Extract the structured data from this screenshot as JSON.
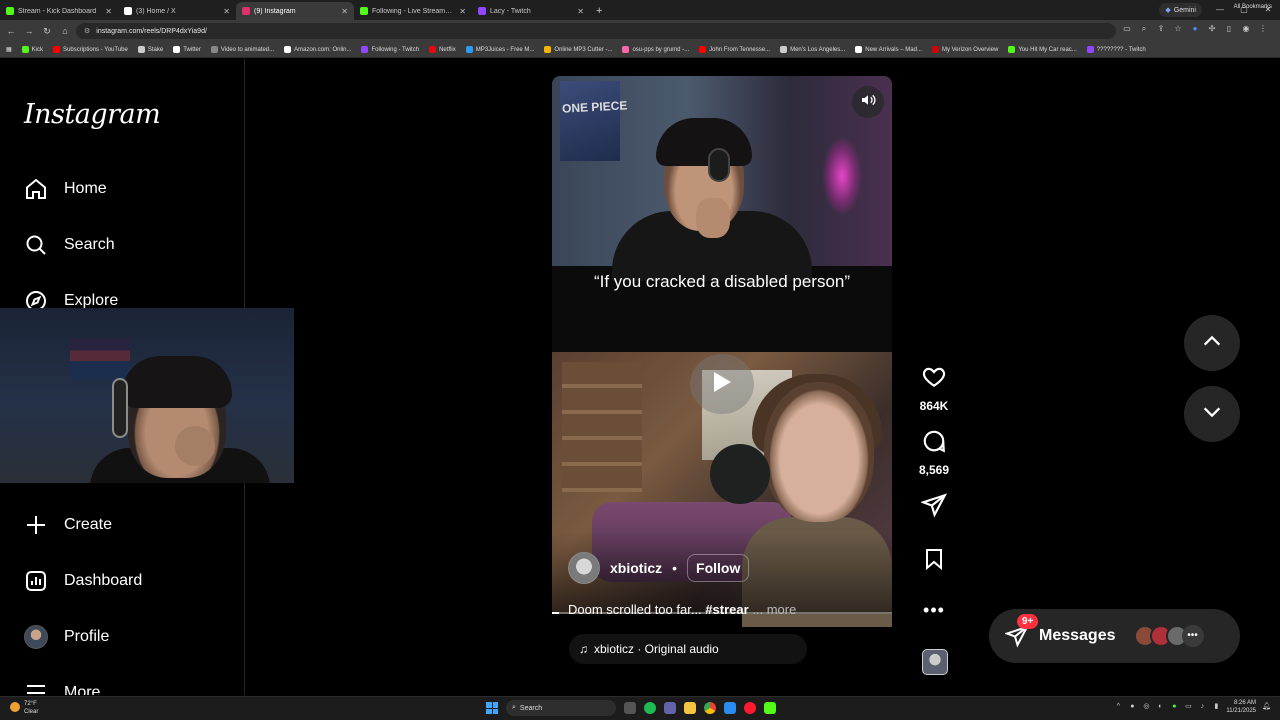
{
  "browser": {
    "tabs": [
      {
        "label": "Stream - Kick Dashboard",
        "color": "#53fc18",
        "active": false
      },
      {
        "label": "(3) Home / X",
        "color": "#ffffff",
        "active": false
      },
      {
        "label": "(9) Instagram",
        "color": "#e1306c",
        "active": true
      },
      {
        "label": "Following - Live Streams on Kick",
        "color": "#53fc18",
        "active": false
      },
      {
        "label": "Lacy - Twitch",
        "color": "#9146ff",
        "active": false
      }
    ],
    "gemini_label": "Gemini",
    "url": "instagram.com/reels/DRP4dxYia9d/",
    "bookmarks": [
      {
        "label": "Kick",
        "color": "#53fc18"
      },
      {
        "label": "Subscriptions - YouTube",
        "color": "#ff0000"
      },
      {
        "label": "Stake",
        "color": "#cccccc"
      },
      {
        "label": "Twitter",
        "color": "#ffffff"
      },
      {
        "label": "Video to animated...",
        "color": "#888888"
      },
      {
        "label": "Amazon.com: Onlin...",
        "color": "#ffffff"
      },
      {
        "label": "Following - Twitch",
        "color": "#9146ff"
      },
      {
        "label": "Netflix",
        "color": "#e50914"
      },
      {
        "label": "MP3Juices - Free M...",
        "color": "#2a9df4"
      },
      {
        "label": "Online MP3 Cutter -...",
        "color": "#f4b400"
      },
      {
        "label": "osu-pps by grumd -...",
        "color": "#ff66aa"
      },
      {
        "label": "John From Tennesse...",
        "color": "#ff0000"
      },
      {
        "label": "Men's Los Angeles...",
        "color": "#cccccc"
      },
      {
        "label": "New Arrivals – Mad...",
        "color": "#ffffff"
      },
      {
        "label": "My Verizon Overview",
        "color": "#cd040b"
      },
      {
        "label": "You Hit My Car reac...",
        "color": "#53fc18"
      },
      {
        "label": "???????? - Twitch",
        "color": "#9146ff"
      }
    ],
    "all_bookmarks_label": "All Bookmarks"
  },
  "sidebar": {
    "logo": "Instagram",
    "items": [
      {
        "label": "Home",
        "icon": "home-icon"
      },
      {
        "label": "Search",
        "icon": "search-icon"
      },
      {
        "label": "Explore",
        "icon": "compass-icon"
      },
      {
        "label": "Create",
        "icon": "plus-icon"
      },
      {
        "label": "Dashboard",
        "icon": "dashboard-icon"
      },
      {
        "label": "Profile",
        "icon": "avatar"
      },
      {
        "label": "More",
        "icon": "menu-icon"
      }
    ]
  },
  "reel1": {
    "caption": "“If you cracked a disabled person”",
    "poster_text": "ONE PIECE"
  },
  "reel2": {
    "username": "xbioticz",
    "separator": "•",
    "follow_label": "Follow",
    "description": "Doom scrolled too far... ",
    "hashtag": "#strear",
    "more_label": " ... more",
    "audio_label": "xbioticz · Original audio",
    "progress": 0.02
  },
  "actions": {
    "likes": "864K",
    "comments": "8,569"
  },
  "messages": {
    "label": "Messages",
    "badge": "9+",
    "avatar_colors": [
      "#8a4a3a",
      "#b0303a",
      "#6a6a6a"
    ]
  },
  "taskbar": {
    "temp": "72°F",
    "condition": "Clear",
    "search_placeholder": "Search",
    "time": "8:26 AM",
    "date": "11/21/2025"
  }
}
